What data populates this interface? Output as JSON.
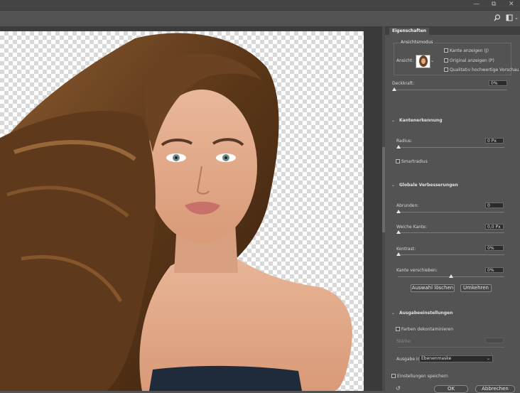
{
  "window": {
    "minimize": "—",
    "restore": "⧉",
    "close": "✕"
  },
  "toolbar": {
    "search_icon": "search-icon",
    "workspace_icon": "workspace-icon",
    "workspace_chevron": "⌄"
  },
  "panel": {
    "tab_label": "Eigenschaften",
    "view_mode": {
      "legend": "Ansichtsmodus",
      "view_label": "Ansicht:",
      "show_edge": "Kante anzeigen (J)",
      "show_original": "Original anzeigen (P)",
      "hq_preview": "Qualitativ hochwertige Vorschau"
    },
    "opacity": {
      "label": "Deckkraft:",
      "value": "0%",
      "level": 0
    },
    "edge_detection": {
      "header": "Kantenerkennung",
      "radius_label": "Radius:",
      "radius_value": "0 Px",
      "radius_level": 0,
      "smart_radius": "Smartradius"
    },
    "global": {
      "header": "Globale Verbesserungen",
      "smooth_label": "Abrunden:",
      "smooth_value": "0",
      "smooth_level": 0,
      "feather_label": "Weiche Kante:",
      "feather_value": "0,0 Px",
      "feather_level": 0,
      "contrast_label": "Kontrast:",
      "contrast_value": "0%",
      "contrast_level": 0,
      "shift_label": "Kante verschieben:",
      "shift_value": "0%",
      "shift_level": 0.5,
      "clear_selection": "Auswahl löschen",
      "invert": "Umkehren"
    },
    "output": {
      "header": "Ausgabeeinstellungen",
      "decontaminate": "Farben dekontaminieren",
      "strength_label": "Stärke:",
      "output_to_label": "Ausgabe in:",
      "output_to_value": "Ebenenmaske"
    },
    "remember": "Einstellungen speichern",
    "ok": "OK",
    "cancel": "Abbrechen"
  }
}
